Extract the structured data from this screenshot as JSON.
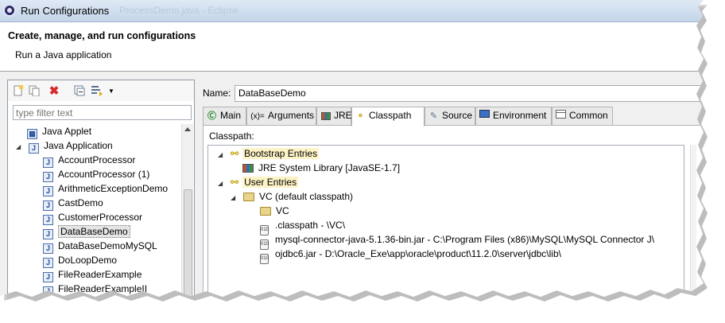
{
  "window": {
    "title": "Run Configurations",
    "background_title": "ProcessDemo.java - Eclipse"
  },
  "header": {
    "title": "Create, manage, and run configurations",
    "subtitle": "Run a Java application"
  },
  "left_toolbar": {
    "icons": [
      "new-launch-config-icon",
      "duplicate-icon",
      "delete-icon",
      "collapse-all-icon",
      "filter-icon",
      "dropdown-arrow-icon"
    ]
  },
  "filter": {
    "placeholder": "type filter text"
  },
  "config_tree": {
    "items": [
      {
        "label": "Java Applet",
        "level": 1,
        "expander": ""
      },
      {
        "label": "Java Application",
        "level": 0,
        "expander": "expanded"
      },
      {
        "label": "AccountProcessor",
        "level": 1
      },
      {
        "label": "AccountProcessor (1)",
        "level": 1
      },
      {
        "label": "ArithmeticExceptionDemo",
        "level": 1
      },
      {
        "label": "CastDemo",
        "level": 1
      },
      {
        "label": "CustomerProcessor",
        "level": 1
      },
      {
        "label": "DataBaseDemo",
        "level": 1,
        "selected": true
      },
      {
        "label": "DataBaseDemoMySQL",
        "level": 1
      },
      {
        "label": "DoLoopDemo",
        "level": 1
      },
      {
        "label": "FileReaderExample",
        "level": 1
      },
      {
        "label": "FileReaderExampleII",
        "level": 1
      }
    ]
  },
  "config": {
    "name_label": "Name:",
    "name_value": "DataBaseDemo"
  },
  "tabs": [
    {
      "label": "Main",
      "icon": "main-tab-icon"
    },
    {
      "label": "Arguments",
      "icon": "arguments-tab-icon",
      "glyph": "(x)="
    },
    {
      "label": "JRE",
      "icon": "jre-tab-icon"
    },
    {
      "label": "Classpath",
      "icon": "classpath-tab-icon",
      "active": true
    },
    {
      "label": "Source",
      "icon": "source-tab-icon"
    },
    {
      "label": "Environment",
      "icon": "environment-tab-icon"
    },
    {
      "label": "Common",
      "icon": "common-tab-icon"
    }
  ],
  "classpath": {
    "label": "Classpath:",
    "entries": [
      {
        "label": "Bootstrap Entries",
        "level": 0,
        "expander": "expanded",
        "icon": "entries-icon",
        "highlight": true
      },
      {
        "label": "JRE System Library [JavaSE-1.7]",
        "level": 1,
        "icon": "library-icon"
      },
      {
        "label": "User Entries",
        "level": 0,
        "expander": "expanded",
        "icon": "entries-icon",
        "highlight": true
      },
      {
        "label": "VC (default classpath)",
        "level": 1,
        "expander": "expanded",
        "icon": "project-folder-icon"
      },
      {
        "label": "VC",
        "level": 2,
        "icon": "folder-icon"
      },
      {
        "label": ".classpath - \\VC\\",
        "level": 2,
        "icon": "file-icon"
      },
      {
        "label": "mysql-connector-java-5.1.36-bin.jar - C:\\Program Files (x86)\\MySQL\\MySQL Connector J\\",
        "level": 2,
        "icon": "jar-icon"
      },
      {
        "label": "ojdbc6.jar - D:\\Oracle_Exe\\app\\oracle\\product\\11.2.0\\server\\jdbc\\lib\\",
        "level": 2,
        "icon": "jar-icon"
      }
    ]
  }
}
